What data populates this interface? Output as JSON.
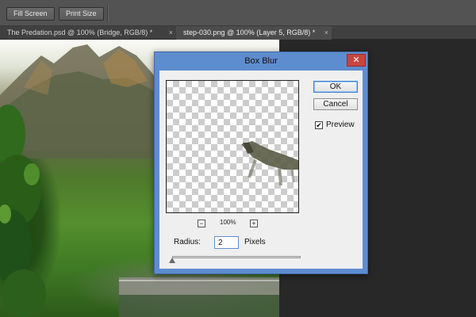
{
  "optionsbar": {
    "fill_screen": "Fill Screen",
    "print_size": "Print Size"
  },
  "tabs": [
    {
      "label": "The Predation.psd @ 100% (Bridge, RGB/8) *",
      "close": "×"
    },
    {
      "label": "step-030.png @ 100% (Layer 5, RGB/8) *",
      "close": "×"
    }
  ],
  "dialog": {
    "title": "Box Blur",
    "close_glyph": "✕",
    "ok_label": "OK",
    "cancel_label": "Cancel",
    "preview_label": "Preview",
    "preview_checked": "✔",
    "zoom_out": "−",
    "zoom_in": "+",
    "zoom_level": "100%",
    "radius_label": "Radius:",
    "radius_value": "2",
    "radius_unit": "Pixels",
    "radius_slider_fraction": 0.0
  },
  "colors": {
    "titlebar": "#5e8dcf",
    "close": "#c7453f",
    "ok_border": "#3c7fd4"
  }
}
